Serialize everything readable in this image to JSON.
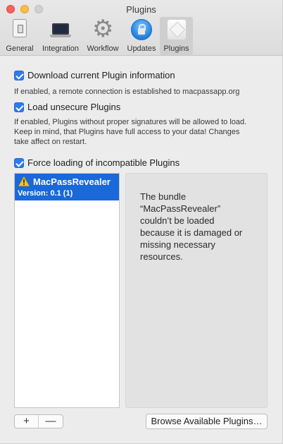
{
  "window": {
    "title": "Plugins"
  },
  "toolbar": {
    "items": [
      {
        "label": "General",
        "icon": "general-icon"
      },
      {
        "label": "Integration",
        "icon": "integration-icon"
      },
      {
        "label": "Workflow",
        "icon": "gear-icon"
      },
      {
        "label": "Updates",
        "icon": "updates-icon"
      },
      {
        "label": "Plugins",
        "icon": "plugins-icon"
      }
    ],
    "active": "Plugins"
  },
  "options": {
    "download_info": {
      "label": "Download current Plugin information",
      "checked": true,
      "help": "If enabled, a remote connection is established to macpassapp.org"
    },
    "load_unsecure": {
      "label": "Load unsecure Plugins",
      "checked": true,
      "help_lines": [
        "If enabled, Plugins without proper signatures will be allowed to load.",
        "Keep in mind, that Plugins have full access to your data! Changes",
        "take affect on restart."
      ]
    },
    "force_incompatible": {
      "label": "Force loading of incompatible Plugins",
      "checked": true
    }
  },
  "plugins": [
    {
      "name": "MacPassRevealer",
      "version": "Version: 0.1 (1)",
      "selected": true,
      "icon": "warning-icon"
    }
  ],
  "detail": {
    "lines": [
      "The bundle",
      "“MacPassRevealer”",
      "couldn’t be loaded",
      "because it is damaged or",
      "missing necessary",
      "resources."
    ]
  },
  "buttons": {
    "add": "+",
    "remove": "—",
    "browse": "Browse Available Plugins…"
  },
  "colors": {
    "accent": "#2b7cf3",
    "selection": "#1a68d9",
    "warning": "#f5c518"
  }
}
